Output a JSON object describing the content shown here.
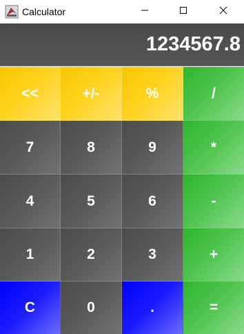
{
  "window": {
    "title": "Calculator",
    "app_icon": "calculator-app-icon",
    "controls": [
      "minimize-icon",
      "maximize-icon",
      "close-icon"
    ]
  },
  "display": {
    "value": "1234567.8"
  },
  "colors": {
    "function_keys": "#FFD21C",
    "digit_keys": "#5A5A5A",
    "operator_keys": "#4CC44C",
    "clear_and_decimal_keys": "#1C1CFF",
    "display_background": "#505050",
    "text": "#FFFFFF"
  },
  "keys": {
    "backspace": "<<",
    "sign": "+/-",
    "percent": "%",
    "divide": "/",
    "seven": "7",
    "eight": "8",
    "nine": "9",
    "multiply": "*",
    "four": "4",
    "five": "5",
    "six": "6",
    "subtract": "-",
    "one": "1",
    "two": "2",
    "three": "3",
    "add": "+",
    "clear": "C",
    "zero": "0",
    "decimal": ".",
    "equals": "="
  }
}
